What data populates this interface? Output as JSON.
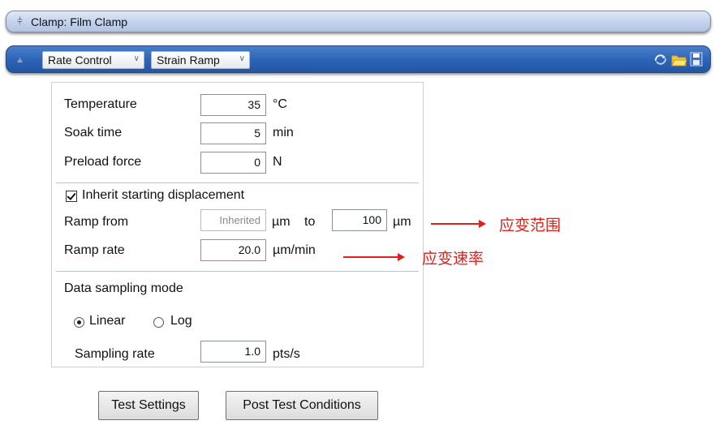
{
  "clamp_bar": {
    "title": "Clamp: Film Clamp"
  },
  "mode_bar": {
    "rate_control": "Rate Control",
    "strain_ramp": "Strain Ramp",
    "icons": [
      "refresh-icon",
      "open-folder-icon",
      "save-icon"
    ]
  },
  "fields": {
    "temperature": {
      "label": "Temperature",
      "value": "35",
      "unit": "°C"
    },
    "soak_time": {
      "label": "Soak time",
      "value": "5",
      "unit": "min"
    },
    "preload_force": {
      "label": "Preload force",
      "value": "0",
      "unit": "N"
    }
  },
  "inherit": {
    "label": "Inherit starting displacement",
    "checked": true
  },
  "ramp_from": {
    "label": "Ramp from",
    "from_value": "Inherited",
    "from_unit": "µm",
    "to_label": "to",
    "to_value": "100",
    "to_unit": "µm"
  },
  "ramp_rate": {
    "label": "Ramp rate",
    "value": "20.0",
    "unit": "µm/min"
  },
  "sampling": {
    "mode_label": "Data sampling mode",
    "linear_label": "Linear",
    "log_label": "Log",
    "selected": "Linear",
    "rate_label": "Sampling rate",
    "rate_value": "1.0",
    "rate_unit": "pts/s"
  },
  "buttons": {
    "test_settings": "Test Settings",
    "post_test": "Post Test Conditions"
  },
  "annotations": {
    "strain_range": "应变范围",
    "strain_rate": "应变速率",
    "color": "#e0201b"
  }
}
